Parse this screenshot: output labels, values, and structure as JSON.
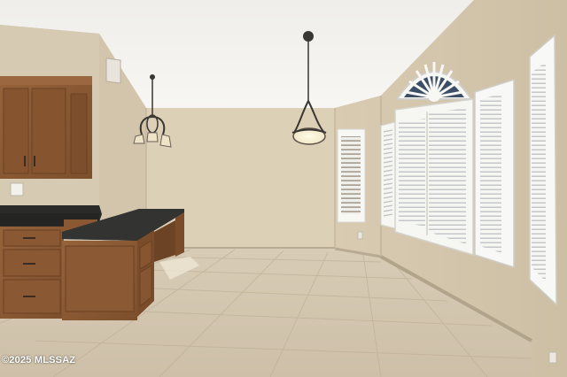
{
  "watermark": {
    "text": "©2025 MLSSAZ"
  },
  "palette": {
    "ceiling": "#f4f3ef",
    "wall_left": "#d7cbb4",
    "wall_back": "#dcd0b8",
    "wall_right": "#d5c7ad",
    "floor": "#d3c6b0",
    "cabinet": "#8a5a33",
    "countertop": "#262624",
    "shutter": "#f7f7f5",
    "baseboard": "#b6a78f"
  }
}
